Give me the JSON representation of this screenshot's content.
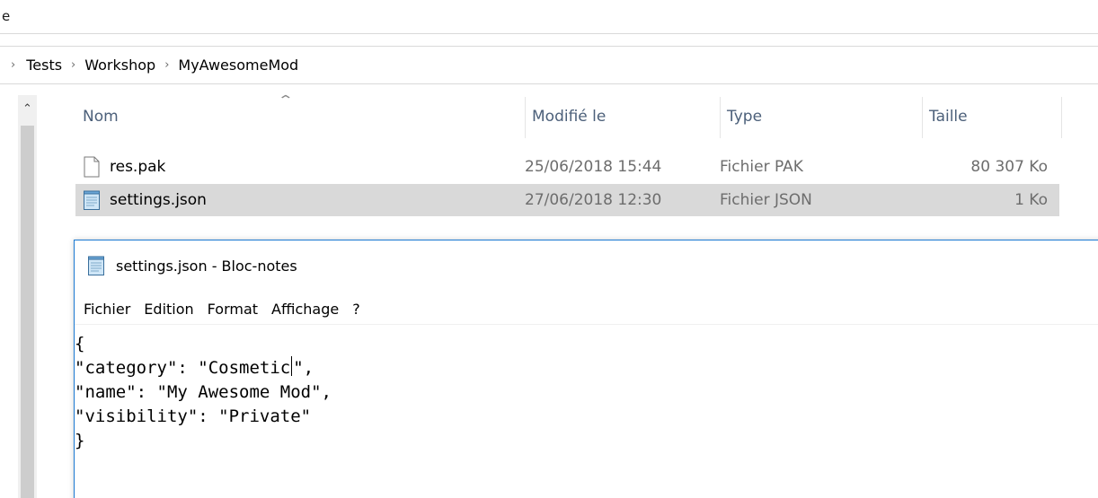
{
  "ribbon": {
    "cut_text": "e"
  },
  "breadcrumb": {
    "items": [
      "Tests",
      "Workshop",
      "MyAwesomeMod"
    ]
  },
  "columns": {
    "name": "Nom",
    "modified": "Modifié le",
    "type": "Type",
    "size": "Taille"
  },
  "files": [
    {
      "name": "res.pak",
      "modified": "25/06/2018 15:44",
      "type": "Fichier PAK",
      "size": "80 307 Ko",
      "icon": "blank-file-icon",
      "selected": false
    },
    {
      "name": "settings.json",
      "modified": "27/06/2018 12:30",
      "type": "Fichier JSON",
      "size": "1 Ko",
      "icon": "notepad-file-icon",
      "selected": true
    }
  ],
  "notepad": {
    "title": "settings.json - Bloc-notes",
    "menu": [
      "Fichier",
      "Edition",
      "Format",
      "Affichage",
      "?"
    ],
    "content": {
      "line1": "{",
      "line2_before_caret": "\"category\": \"Cosmetic",
      "line2_after_caret": "\",",
      "line3": "\"name\": \"My Awesome Mod\",",
      "line4": "\"visibility\": \"Private\"",
      "line5": "}"
    }
  },
  "colors": {
    "selected_row": "#d9d9d9",
    "notepad_border": "#1a79d2",
    "header_text": "#4c607a"
  }
}
